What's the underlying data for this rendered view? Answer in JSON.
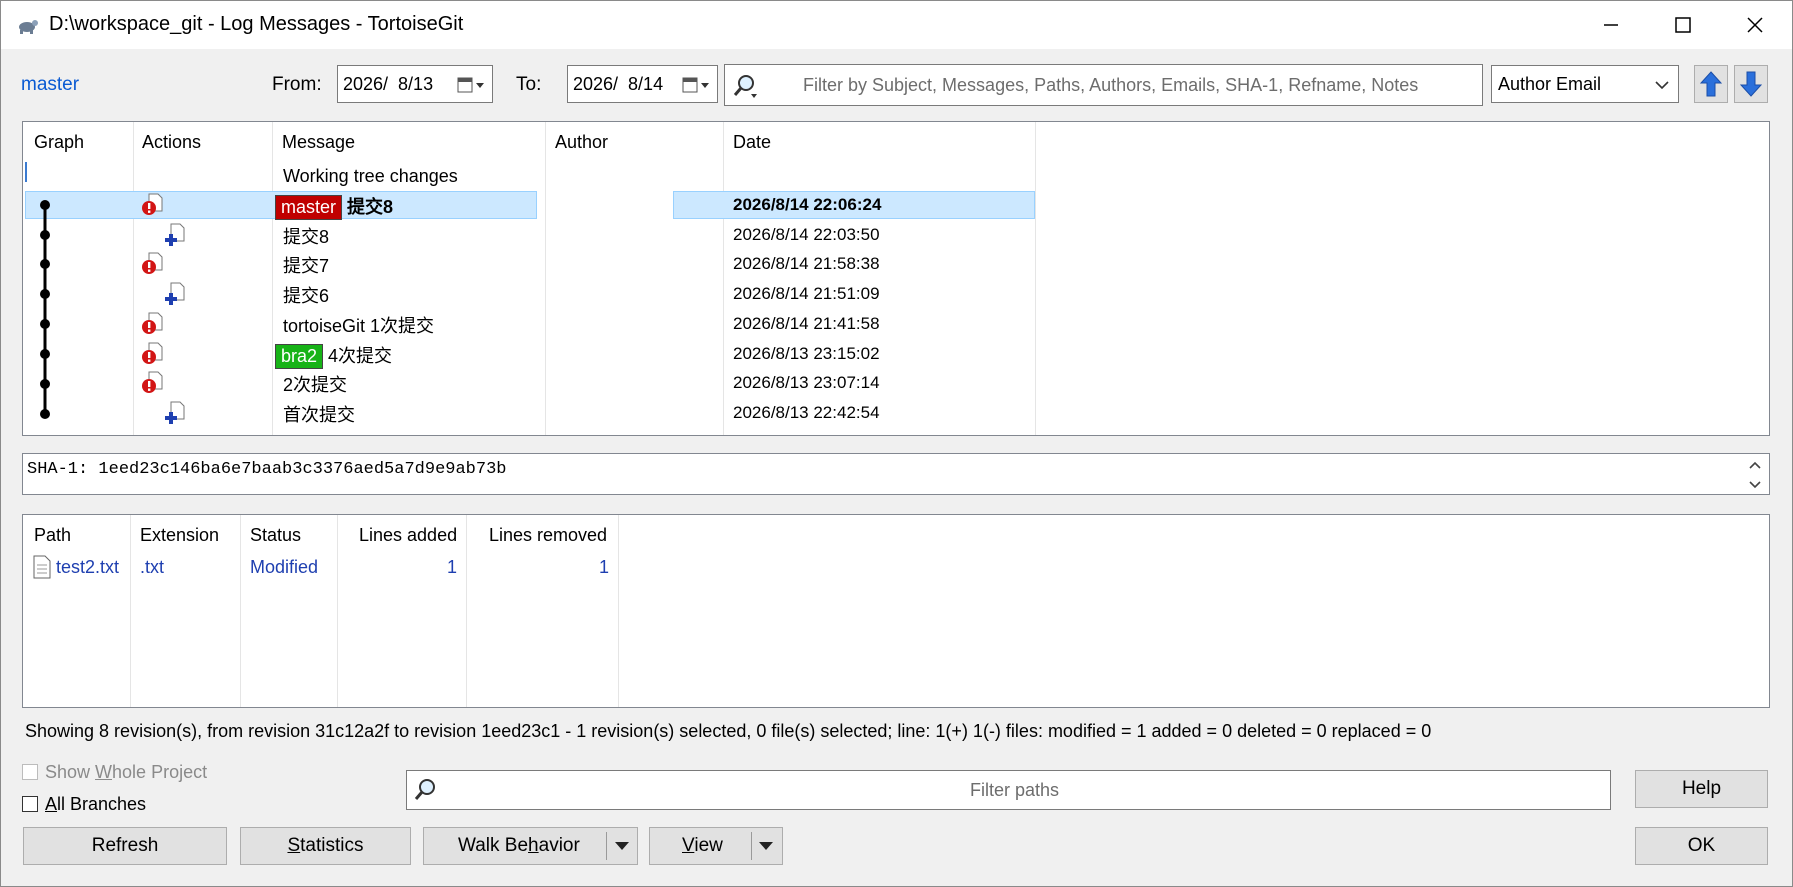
{
  "window": {
    "title": "D:\\workspace_git - Log Messages - TortoiseGit",
    "icon": "tortoise-icon"
  },
  "toolbar": {
    "branch_link": "master",
    "from_label": "From:",
    "from_date": "2026/  8/13",
    "to_label": "To:",
    "to_date": "2026/  8/14",
    "filter_placeholder": "Filter by Subject, Messages, Paths, Authors, Emails, SHA-1, Refname, Notes",
    "filter_field": "Author Email"
  },
  "log": {
    "columns": [
      "Graph",
      "Actions",
      "Message",
      "Author",
      "Date"
    ],
    "working_tree": "Working tree changes",
    "rows": [
      {
        "action": "modify",
        "ref": "master",
        "ref_color": "#c00000",
        "message": "提交8",
        "date": "2026/8/14 22:06:24",
        "selected": true
      },
      {
        "action": "add",
        "ref": "",
        "message": "提交8",
        "date": "2026/8/14 22:03:50"
      },
      {
        "action": "modify",
        "ref": "",
        "message": "提交7",
        "date": "2026/8/14 21:58:38"
      },
      {
        "action": "add",
        "ref": "",
        "message": "提交6",
        "date": "2026/8/14 21:51:09"
      },
      {
        "action": "modify",
        "ref": "",
        "message": "tortoiseGit 1次提交",
        "date": "2026/8/14 21:41:58"
      },
      {
        "action": "modify",
        "ref": "bra2",
        "ref_color": "#17b317",
        "message": "4次提交",
        "date": "2026/8/13 23:15:02"
      },
      {
        "action": "modify",
        "ref": "",
        "message": "2次提交",
        "date": "2026/8/13 23:07:14"
      },
      {
        "action": "add",
        "ref": "",
        "message": "首次提交",
        "date": "2026/8/13 22:42:54"
      }
    ]
  },
  "detail": {
    "sha_text": "SHA-1: 1eed23c146ba6e7baab3c3376aed5a7d9e9ab73b"
  },
  "files": {
    "columns": [
      "Path",
      "Extension",
      "Status",
      "Lines added",
      "Lines removed"
    ],
    "rows": [
      {
        "path": "test2.txt",
        "ext": ".txt",
        "status": "Modified",
        "added": "1",
        "removed": "1"
      }
    ]
  },
  "status_text": "Showing 8 revision(s), from revision 31c12a2f to revision 1eed23c1 - 1 revision(s) selected, 0 file(s) selected; line: 1(+) 1(-) files: modified = 1 added = 0 deleted = 0 replaced = 0",
  "bottom": {
    "show_whole_project_pre": "Show ",
    "show_whole_project_u": "W",
    "show_whole_project_post": "hole Project",
    "all_branches_pre": "",
    "all_branches_u": "A",
    "all_branches_post": "ll Branches",
    "filter_paths_placeholder": "Filter paths",
    "help": "Help",
    "refresh": "Refresh",
    "statistics_pre": "",
    "statistics_u": "S",
    "statistics_post": "tatistics",
    "walk_pre": "Walk Be",
    "walk_u": "h",
    "walk_post": "avior",
    "view_pre": "",
    "view_u": "V",
    "view_post": "iew",
    "ok": "OK"
  },
  "colors": {
    "accent_blue": "#2a6fdb",
    "selection": "#cce8ff",
    "link": "#0b5bd3"
  }
}
